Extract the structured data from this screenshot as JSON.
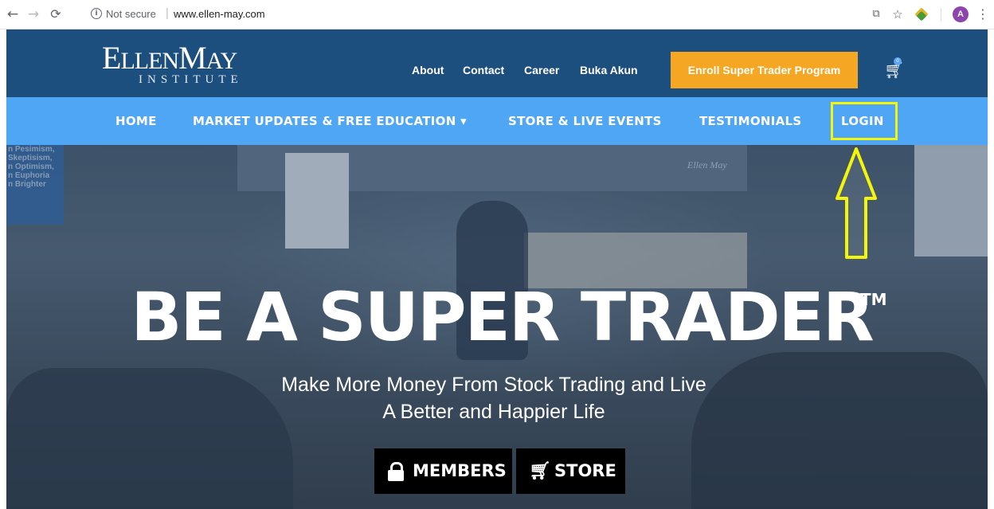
{
  "browser": {
    "security_label": "Not secure",
    "url": "www.ellen-may.com",
    "avatar_letter": "A",
    "icons": [
      "back-icon",
      "forward-icon",
      "reload-icon",
      "info-icon",
      "translate-icon",
      "star-icon",
      "extension-icon",
      "menu-icon"
    ]
  },
  "header": {
    "logo_main_1": "E",
    "logo_main_2": "LLEN",
    "logo_main_3": "M",
    "logo_main_4": "AY",
    "logo_sub": "INSTITUTE",
    "links": [
      "About",
      "Contact",
      "Career",
      "Buka Akun"
    ],
    "enroll_label": "Enroll Super Trader Program",
    "cart_count": "0",
    "accent_color": "#f5a623",
    "header_color": "#1d4f7e"
  },
  "nav": {
    "items": [
      "HOME",
      "MARKET UPDATES & FREE EDUCATION ▾",
      "STORE & LIVE EVENTS",
      "TESTIMONIALS",
      "LOGIN"
    ],
    "nav_color": "#4ea6f5",
    "highlight_color": "#f5f50a"
  },
  "hero": {
    "sign_lines": [
      "n Pesimism,",
      "Skeptisism,",
      "n Optimism,",
      "n Euphoria",
      "n Brighter"
    ],
    "title": "BE A SUPER TRADER",
    "trademark": "TM",
    "subtitle_line1": "Make More Money From Stock Trading and Live",
    "subtitle_line2": "A Better and Happier Life",
    "members_label": "MEMBERS",
    "store_label": "STORE",
    "screen_text": "Ellen May"
  }
}
